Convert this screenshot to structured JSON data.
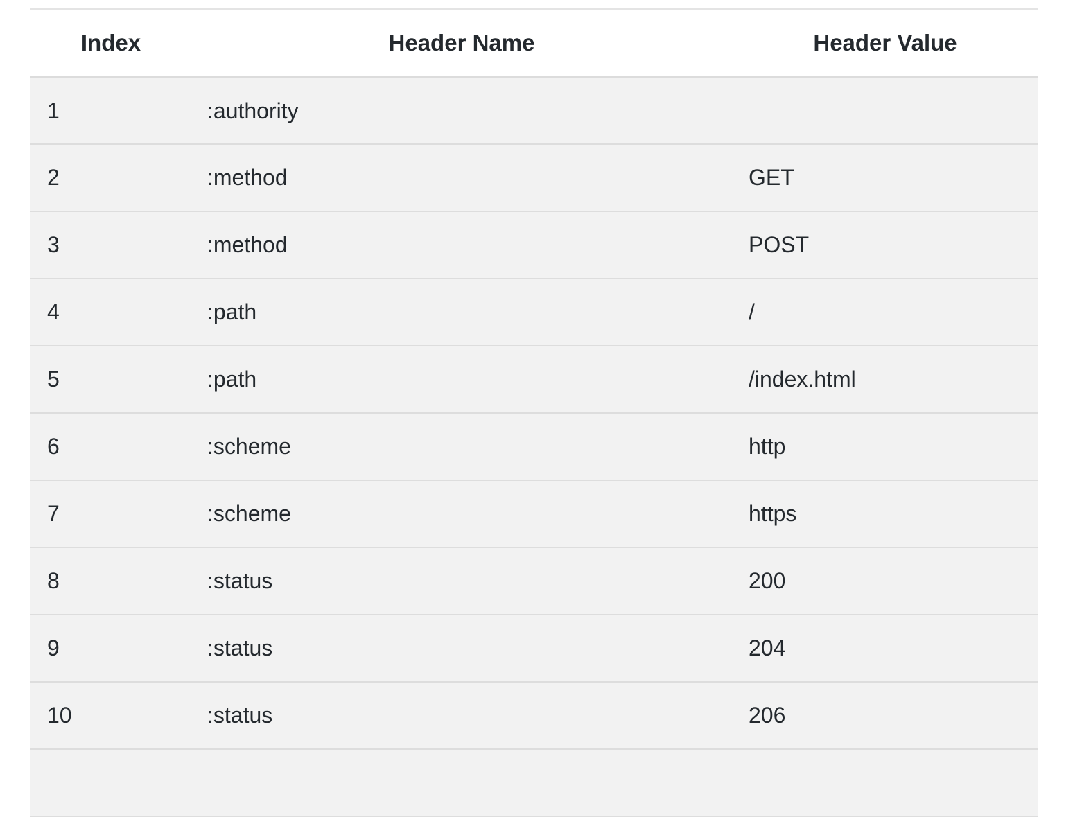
{
  "table": {
    "headers": {
      "index": "Index",
      "name": "Header Name",
      "value": "Header Value"
    },
    "rows": [
      {
        "index": "1",
        "name": ":authority",
        "value": ""
      },
      {
        "index": "2",
        "name": ":method",
        "value": "GET"
      },
      {
        "index": "3",
        "name": ":method",
        "value": "POST"
      },
      {
        "index": "4",
        "name": ":path",
        "value": "/"
      },
      {
        "index": "5",
        "name": ":path",
        "value": "/index.html"
      },
      {
        "index": "6",
        "name": ":scheme",
        "value": "http"
      },
      {
        "index": "7",
        "name": ":scheme",
        "value": "https"
      },
      {
        "index": "8",
        "name": ":status",
        "value": "200"
      },
      {
        "index": "9",
        "name": ":status",
        "value": "204"
      },
      {
        "index": "10",
        "name": ":status",
        "value": "206"
      }
    ]
  }
}
